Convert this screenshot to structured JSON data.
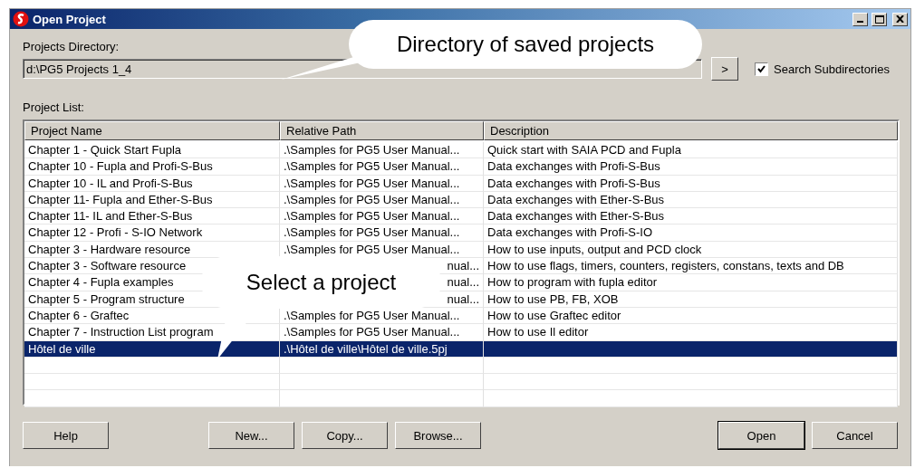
{
  "window": {
    "title": "Open Project"
  },
  "directory": {
    "label": "Projects Directory:",
    "value": "d:\\PG5 Projects 1_4",
    "go_button": ">"
  },
  "search_subdirectories": {
    "label": "Search Subdirectories",
    "checked": true
  },
  "project_list": {
    "label": "Project List:",
    "columns": [
      "Project Name",
      "Relative Path",
      "Description"
    ],
    "rows": [
      {
        "name": "Chapter 1 - Quick Start Fupla",
        "path": ".\\Samples for PG5 User Manual...",
        "description": "Quick start with SAIA PCD and Fupla",
        "selected": false
      },
      {
        "name": "Chapter 10 - Fupla and Profi-S-Bus",
        "path": ".\\Samples for PG5 User Manual...",
        "description": "Data exchanges with Profi-S-Bus",
        "selected": false
      },
      {
        "name": "Chapter 10 - IL and Profi-S-Bus",
        "path": ".\\Samples for PG5 User Manual...",
        "description": "Data exchanges with Profi-S-Bus",
        "selected": false
      },
      {
        "name": "Chapter 11- Fupla and Ether-S-Bus",
        "path": ".\\Samples for PG5 User Manual...",
        "description": "Data exchanges with Ether-S-Bus",
        "selected": false
      },
      {
        "name": "Chapter 11- IL and Ether-S-Bus",
        "path": ".\\Samples for PG5 User Manual...",
        "description": "Data exchanges with Ether-S-Bus",
        "selected": false
      },
      {
        "name": "Chapter 12 - Profi - S-IO Network",
        "path": ".\\Samples for PG5 User Manual...",
        "description": "Data exchanges  with Profi-S-IO",
        "selected": false
      },
      {
        "name": "Chapter 3 - Hardware resource",
        "path": ".\\Samples for PG5 User Manual...",
        "description": "How to use inputs, output and PCD clock",
        "selected": false
      },
      {
        "name": "Chapter 3 - Software  resource",
        "path": "nual...",
        "description": "How to use flags, timers, counters, registers, constans, texts and DB",
        "selected": false
      },
      {
        "name": "Chapter 4 - Fupla examples",
        "path": "nual...",
        "description": "How to program with fupla editor",
        "selected": false
      },
      {
        "name": "Chapter 5 - Program structure",
        "path": "nual...",
        "description": "How to use  PB, FB, XOB",
        "selected": false
      },
      {
        "name": "Chapter 6 - Graftec",
        "path": ".\\Samples for PG5 User Manual...",
        "description": "How to  use Graftec editor",
        "selected": false
      },
      {
        "name": "Chapter 7 - Instruction List program",
        "path": ".\\Samples for PG5 User Manual...",
        "description": "How to use Il editor",
        "selected": false
      },
      {
        "name": "Hôtel de ville",
        "path": ".\\Hôtel de ville\\Hôtel de ville.5pj",
        "selected": true
      }
    ]
  },
  "buttons": [
    {
      "label": "Help",
      "kind": "left"
    },
    {
      "label": "New...",
      "kind": "middle"
    },
    {
      "label": "Copy...",
      "kind": "middle"
    },
    {
      "label": "Browse...",
      "kind": "middle"
    },
    {
      "label": "Open",
      "kind": "default"
    },
    {
      "label": "Cancel",
      "kind": "right"
    }
  ],
  "callouts": [
    "Directory of saved projects",
    "Select a project"
  ]
}
